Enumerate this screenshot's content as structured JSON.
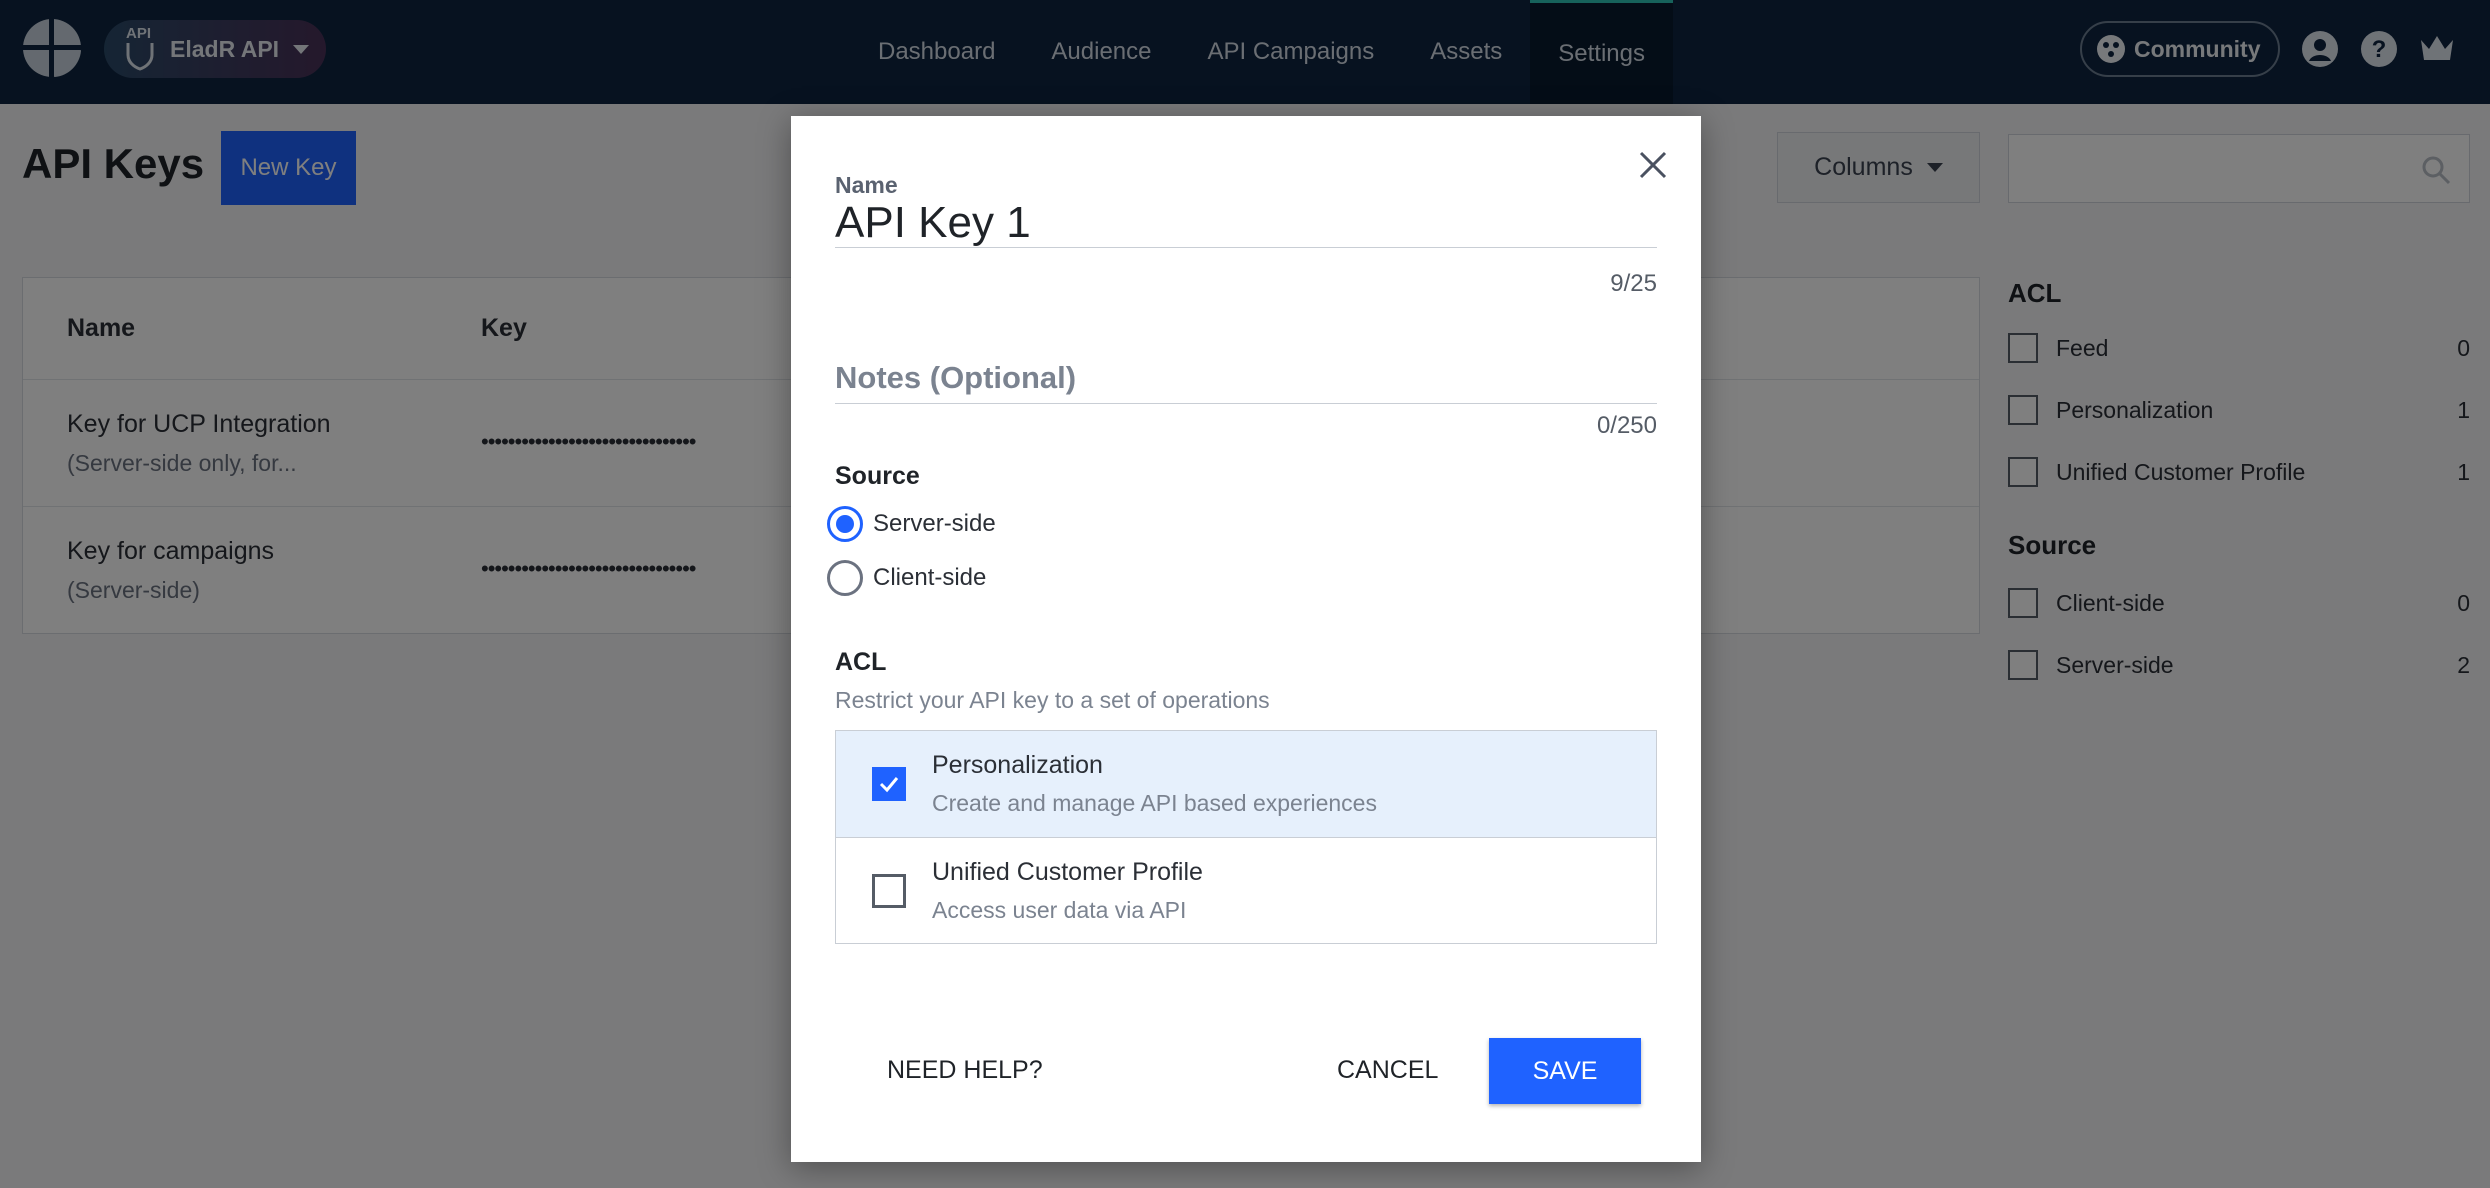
{
  "topbar": {
    "app_badge": "API",
    "app_name": "EladR API",
    "nav": [
      "Dashboard",
      "Audience",
      "API Campaigns",
      "Assets",
      "Settings"
    ],
    "active_nav": "Settings",
    "community_label": "Community",
    "icons": [
      "account-icon",
      "help-icon",
      "crown-icon"
    ]
  },
  "page": {
    "title": "API Keys",
    "new_key_label": "New Key",
    "columns_label": "Columns",
    "search_placeholder": ""
  },
  "table": {
    "headers": [
      "Name",
      "Key"
    ],
    "rows": [
      {
        "name": "Key for UCP Integration",
        "sub": "(Server-side only, for...",
        "key": "••••••••••••••••••••••••••••••••"
      },
      {
        "name": "Key for campaigns",
        "sub": "(Server-side)",
        "key": "••••••••••••••••••••••••••••••••"
      }
    ]
  },
  "filters": {
    "acl_title": "ACL",
    "acl": [
      {
        "label": "Feed",
        "count": "0"
      },
      {
        "label": "Personalization",
        "count": "1"
      },
      {
        "label": "Unified Customer Profile",
        "count": "1"
      }
    ],
    "source_title": "Source",
    "source": [
      {
        "label": "Client-side",
        "count": "0"
      },
      {
        "label": "Server-side",
        "count": "2"
      }
    ]
  },
  "modal": {
    "name_label": "Name",
    "name_value": "API Key 1",
    "name_counter": "9/25",
    "notes_placeholder": "Notes (Optional)",
    "notes_counter": "0/250",
    "source_title": "Source",
    "source_options": [
      "Server-side",
      "Client-side"
    ],
    "source_selected": "Server-side",
    "acl_title": "ACL",
    "acl_desc": "Restrict your API key to a set of operations",
    "acl_items": [
      {
        "title": "Personalization",
        "sub": "Create and manage API based experiences",
        "checked": true
      },
      {
        "title": "Unified Customer Profile",
        "sub": "Access user data via API",
        "checked": false
      }
    ],
    "help_label": "NEED HELP?",
    "cancel_label": "CANCEL",
    "save_label": "SAVE"
  },
  "colors": {
    "topbar": "#0f2540",
    "accent": "#1f62ff",
    "active_tab_marker": "#2ec4b6"
  }
}
